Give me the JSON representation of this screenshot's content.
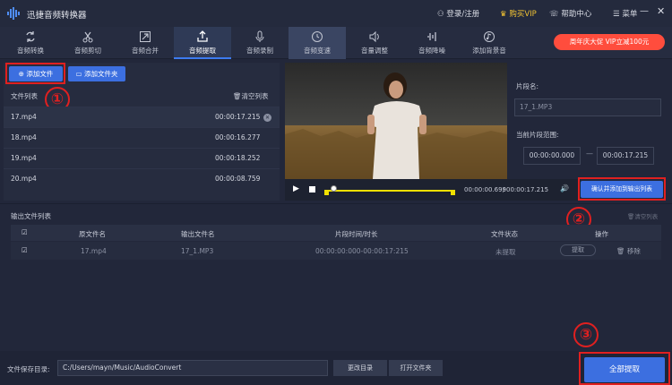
{
  "app": {
    "title": "迅捷音频转换器"
  },
  "header": {
    "login": "登录/注册",
    "vip": "购买VIP",
    "help": "帮助中心",
    "menu": "菜单",
    "minimize": "—",
    "close": "✕"
  },
  "tabs": [
    {
      "label": "音频转换",
      "icon": "convert-icon"
    },
    {
      "label": "音频剪切",
      "icon": "scissors-icon"
    },
    {
      "label": "音频合并",
      "icon": "merge-icon"
    },
    {
      "label": "音频提取",
      "icon": "extract-icon"
    },
    {
      "label": "音频录制",
      "icon": "microphone-icon"
    },
    {
      "label": "音频变速",
      "icon": "speed-icon"
    },
    {
      "label": "音量调整",
      "icon": "volume-icon"
    },
    {
      "label": "音频降噪",
      "icon": "denoise-icon"
    },
    {
      "label": "添加背景音",
      "icon": "music-icon"
    }
  ],
  "active_tab": "音频提取",
  "promo": "周年庆大促 VIP立减100元",
  "left": {
    "add_file": "添加文件",
    "add_folder": "添加文件夹",
    "file_list_title": "文件列表",
    "clear_list": "清空列表",
    "files": [
      {
        "name": "17.mp4",
        "duration": "00:00:17.215"
      },
      {
        "name": "18.mp4",
        "duration": "00:00:16.277"
      },
      {
        "name": "19.mp4",
        "duration": "00:00:18.252"
      },
      {
        "name": "20.mp4",
        "duration": "00:00:08.759"
      }
    ]
  },
  "player": {
    "current_time": "00:00:00.699",
    "separator": "/",
    "total_time": "00:00:17.215"
  },
  "segment": {
    "name_label": "片段名:",
    "name_value": "17_1.MP3",
    "range_label": "当前片段范围:",
    "range_start": "00:00:00.000",
    "range_dash": "—",
    "range_end": "00:00:17.215",
    "confirm": "确认并添加到输出列表"
  },
  "output": {
    "title": "输出文件列表",
    "clear": "清空列表",
    "headers": {
      "check": "☑",
      "src": "原文件名",
      "out": "输出文件名",
      "seg": "片段时间/时长",
      "status": "文件状态",
      "ops": "操作"
    },
    "rows": [
      {
        "check": "☑",
        "src": "17.mp4",
        "out": "17_1.MP3",
        "seg": "00:00:00:000-00:00:17:215",
        "status": "未提取",
        "extract": "提取",
        "remove": "移除"
      }
    ]
  },
  "bottom": {
    "save_label": "文件保存目录:",
    "save_path": "C:/Users/mayn/Music/AudioConvert",
    "change_dir": "更改目录",
    "open_folder": "打开文件夹",
    "extract_all": "全部提取"
  },
  "annotations": {
    "one": "①",
    "two": "②",
    "three": "③"
  },
  "colors": {
    "accent": "#3c6fe0",
    "highlight": "#e02020",
    "background": "#22273a",
    "promo": "#ff4d3d",
    "vip": "#f1c232"
  },
  "playback_fraction": 0.04
}
